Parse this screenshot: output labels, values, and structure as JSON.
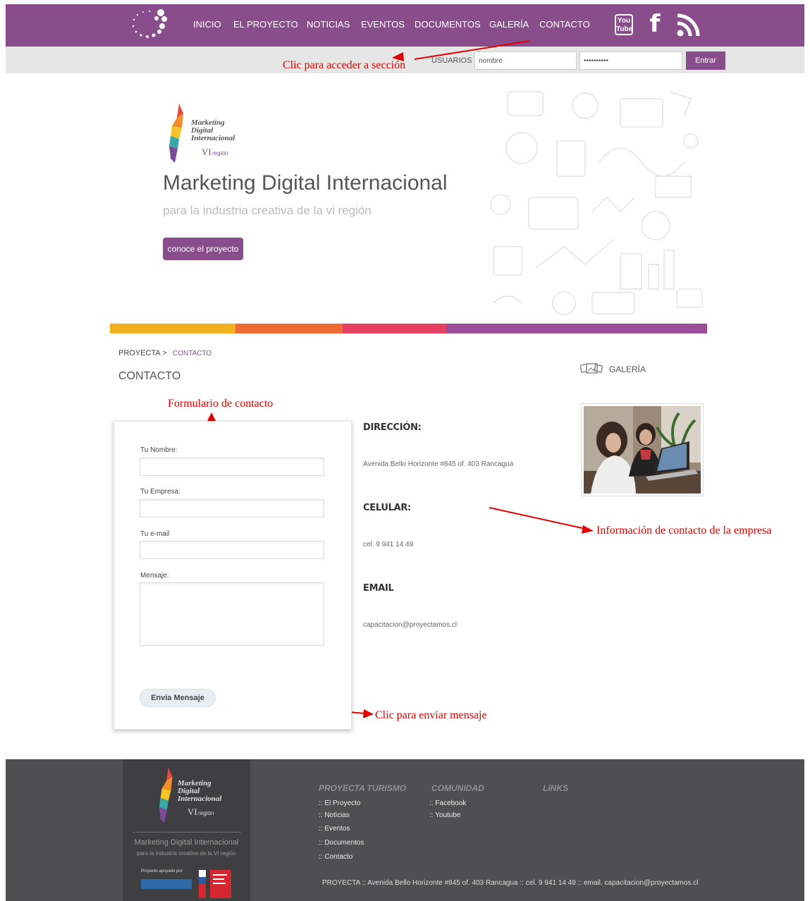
{
  "nav": {
    "items": [
      "INICIO",
      "EL PROYECTO",
      "NOTICIAS",
      "EVENTOS",
      "DOCUMENTOS",
      "GALERÍA",
      "CONTACTO"
    ],
    "youtube_text": "You Tube"
  },
  "login": {
    "label": "USUARIOS",
    "user_value": "nombre",
    "password_value": "••••••••••",
    "button": "Entrar"
  },
  "annotations": {
    "section": "Clic para acceder a sección",
    "form": "Formulario de contacto",
    "company": "Información de contacto de la empresa",
    "send": "Clic para enviar mensaje"
  },
  "logo": {
    "line1": "Marketing",
    "line2": "Digital",
    "line3": "Internacional",
    "line4": "VI",
    "line5": "región"
  },
  "hero": {
    "title": "Marketing Digital Internacional",
    "subtitle": "para la industria creativa de la vi región",
    "button": "conoce el proyecto"
  },
  "stripe_colors": [
    "#f2b01e",
    "#ef6b34",
    "#e84060",
    "#9b4f9a"
  ],
  "breadcrumb": {
    "home": "PROYECTA >",
    "current": "CONTACTO"
  },
  "page_title": "CONTACTO",
  "form": {
    "name_label": "Tu Nombre:",
    "company_label": "Tu Empresa:",
    "email_label": "Tu e-mail",
    "message_label": "Mensaje:",
    "send_button": "Envia Mensaje"
  },
  "info": {
    "address_head": "DIRECCIÓN:",
    "address": "Avenida Bello Horizonte #845 of. 403 Rancagua",
    "phone_head": "CELULAR:",
    "phone": "cel. 9 941 14 49",
    "email_head": "EMAIL",
    "email": "capacitacion@proyectamos.cl"
  },
  "sidebar": {
    "gallery_title": "GALERÍA"
  },
  "footer": {
    "name": "Marketing Digital Internacional",
    "tagline": "para la industria creativa de la VI región",
    "support_label": "Proyecto apoyado por",
    "col1_title": "PROYECTA TURISMO",
    "col1_links": [
      ":: El Proyecto",
      ":: Noticias",
      ":: Eventos",
      ":: Documentos",
      ":: Contacto"
    ],
    "col2_title": "COMUNIDAD",
    "col2_links": [
      ":: Facebook",
      ":: Youtube"
    ],
    "col3_title": "LINKS",
    "bottom_line": "PROYECTA :: Avenida Bello Horizonte #845 of. 403 Rancagua :: cel. 9 941 14 49 :: email. capacitacion@proyectamos.cl"
  }
}
